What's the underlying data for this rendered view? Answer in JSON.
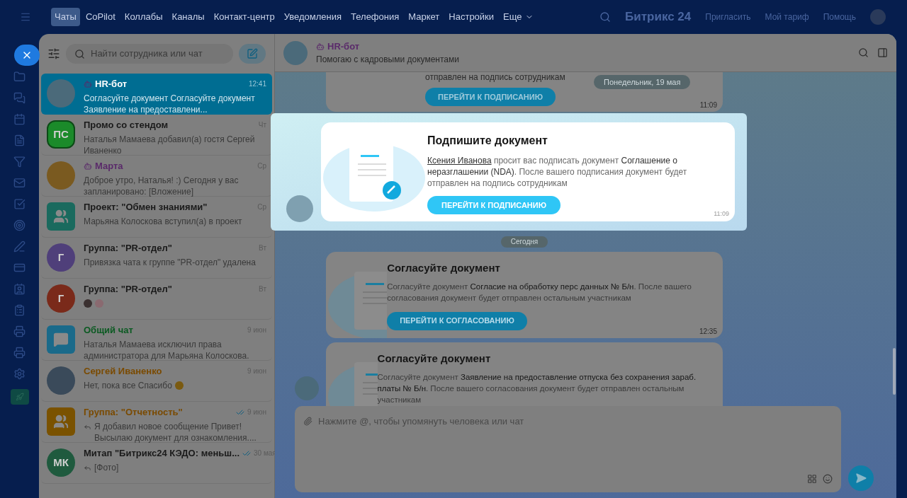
{
  "top_nav": {
    "items": [
      {
        "label": "Чаты",
        "selected": true
      },
      {
        "label": "CoPilot",
        "selected": false
      },
      {
        "label": "Коллабы",
        "selected": false
      },
      {
        "label": "Каналы",
        "selected": false
      },
      {
        "label": "Контакт-центр",
        "selected": false
      },
      {
        "label": "Уведомления",
        "selected": false
      },
      {
        "label": "Телефония",
        "selected": false
      },
      {
        "label": "Маркет",
        "selected": false
      },
      {
        "label": "Настройки",
        "selected": false
      },
      {
        "label": "Еще",
        "selected": false
      }
    ],
    "logo": "Битрикс 24",
    "actions": [
      "Пригласить",
      "Мой тариф",
      "Помощь"
    ]
  },
  "chat_list": {
    "search": {
      "placeholder": "Найти сотрудника или чат"
    },
    "items": [
      {
        "name": "HR-бот",
        "bot": true,
        "color": "#ffffff",
        "time": "12:41",
        "preview": "Согласуйте документ Согласуйте документ Заявление на предоставлени...",
        "selected": true,
        "avatar": {
          "kind": "photo",
          "color": "#4b6a7a"
        }
      },
      {
        "name": "Промо со стендом",
        "bot": false,
        "color": "#1a1a1a",
        "time": "Чт",
        "preview": "Наталья Мамаева добавил(а) гостя Сергей Иваненко",
        "selected": false,
        "avatar": {
          "kind": "hexagon",
          "initials": "ПС",
          "color": "#1b8a2a"
        }
      },
      {
        "name": "Марта",
        "bot": true,
        "color": "#5a2a6a",
        "time": "Ср",
        "preview": "Доброе утро, Наталья! :) Сегодня у вас запланировано: [Вложение]",
        "selected": false,
        "avatar": {
          "kind": "photo",
          "color": "#7a5a20"
        }
      },
      {
        "name": "Проект: \"Обмен знаниями\"",
        "bot": false,
        "color": "#1a1a1a",
        "time": "Ср",
        "preview": "Марьяна Колоскова вступил(а) в проект",
        "selected": false,
        "avatar": {
          "kind": "group",
          "color": "#1a6a5e"
        }
      },
      {
        "name": "Группа: \"PR-отдел\"",
        "bot": false,
        "color": "#1a1a1a",
        "time": "Вт",
        "preview": "Привязка чата к группе \"PR-отдел\" удалена",
        "selected": false,
        "avatar": {
          "kind": "initials",
          "initials": "Г",
          "color": "#4f3f7a"
        }
      },
      {
        "name": "Группа: \"PR-отдел\"",
        "bot": false,
        "color": "#1a1a1a",
        "time": "Вт",
        "preview_icons": true,
        "selected": false,
        "avatar": {
          "kind": "initials",
          "initials": "Г",
          "color": "#7a2a1a"
        }
      },
      {
        "name": "Общий чат",
        "bot": false,
        "color": "#0b5a22",
        "time": "9 июн",
        "preview": "Наталья Мамаева исключил права администратора для Марьяна Колоскова.",
        "selected": false,
        "avatar": {
          "kind": "chat-app",
          "color": "#1a6a8a"
        }
      },
      {
        "name": "Сергей Иваненко",
        "bot": false,
        "color": "#7a4a00",
        "time": "9 июн",
        "preview": "Нет, пока все Спасибо",
        "emoji": true,
        "selected": false,
        "avatar": {
          "kind": "photo",
          "color": "#3a4a5a"
        }
      },
      {
        "name": "Группа: \"Отчетность\"",
        "bot": false,
        "color": "#7a4a00",
        "time": "9 июн",
        "read": true,
        "reply": true,
        "preview": "Я добавил новое сообщение Привет! Высылаю документ для ознакомления....",
        "selected": false,
        "avatar": {
          "kind": "group",
          "color": "#7a5200"
        }
      },
      {
        "name": "Митап \"Битрикс24 КЭДО: меньш...",
        "bot": false,
        "color": "#1a1a1a",
        "time": "30 мая",
        "read": true,
        "reply": true,
        "preview": "[Фото]",
        "selected": false,
        "avatar": {
          "kind": "initials",
          "initials": "МК",
          "color": "#1f5a3e"
        }
      }
    ]
  },
  "chat_header": {
    "name": "HR-бот",
    "status": "Помогаю с кадровыми документами"
  },
  "messages": {
    "top_fragment": {
      "text": "отправлен на подпись сотрудникам",
      "button": "ПЕРЕЙТИ К ПОДПИСАНИЮ",
      "time": "11:09"
    },
    "date_chips": [
      "Понедельник, 19 мая",
      "Сегодня"
    ],
    "cards": [
      {
        "title": "Согласуйте документ",
        "text": "Согласуйте документ **Согласие на обработку перс данных № Б/н**. После вашего согласования документ будет отправлен остальным участникам",
        "button": "ПЕРЕЙТИ К СОГЛАСОВАНИЮ",
        "time": "12:35"
      },
      {
        "title": "Согласуйте документ",
        "text": "Согласуйте документ **Заявление на предоставление отпуска без сохранения зараб. платы № Б/н**. После вашего согласования документ будет отправлен остальным участникам"
      }
    ]
  },
  "highlight_card": {
    "title": "Подпишите документ",
    "author": "Ксения Иванова",
    "text": "просит вас подписать документ **Соглашение о неразглашении (NDA)**. После вашего подписания документ будет отправлен на подпись сотрудникам",
    "button": "ПЕРЕЙТИ К ПОДПИСАНИЮ",
    "time": "11:09"
  },
  "composer": {
    "placeholder": "Нажмите @, чтобы упомянуть человека или чат"
  }
}
